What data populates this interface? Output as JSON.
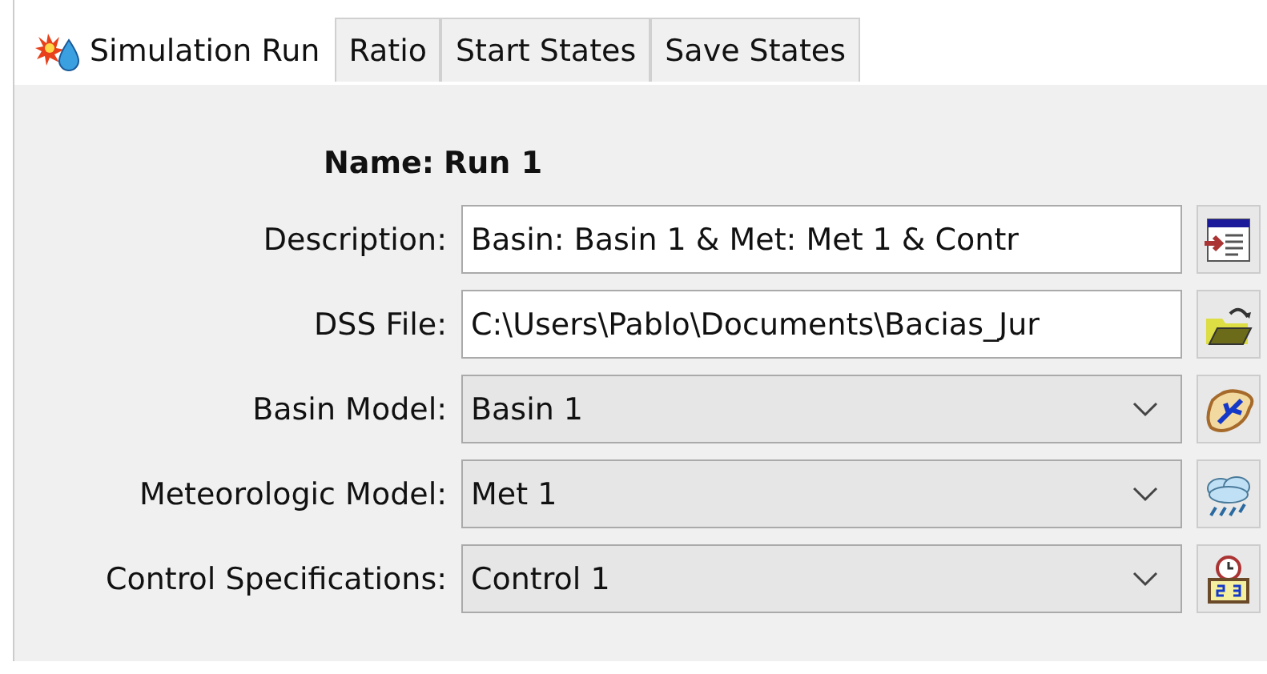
{
  "tabs": [
    {
      "label": "Simulation Run",
      "selected": true
    },
    {
      "label": "Ratio",
      "selected": false
    },
    {
      "label": "Start States",
      "selected": false
    },
    {
      "label": "Save States",
      "selected": false
    }
  ],
  "name": {
    "label": "Name:",
    "value": "Run 1"
  },
  "fields": [
    {
      "kind": "text",
      "label": "Description:",
      "value": "Basin: Basin 1 & Met: Met 1 & Contr"
    },
    {
      "kind": "text",
      "label": "DSS File:",
      "value": "C:\\Users\\Pablo\\Documents\\Bacias_Jur"
    },
    {
      "kind": "dropdown",
      "label": "Basin Model:",
      "value": "Basin 1"
    },
    {
      "kind": "dropdown",
      "label": "Meteorologic Model:",
      "value": "Met 1"
    },
    {
      "kind": "dropdown",
      "label": "Control Specifications:",
      "value": "Control 1"
    }
  ]
}
